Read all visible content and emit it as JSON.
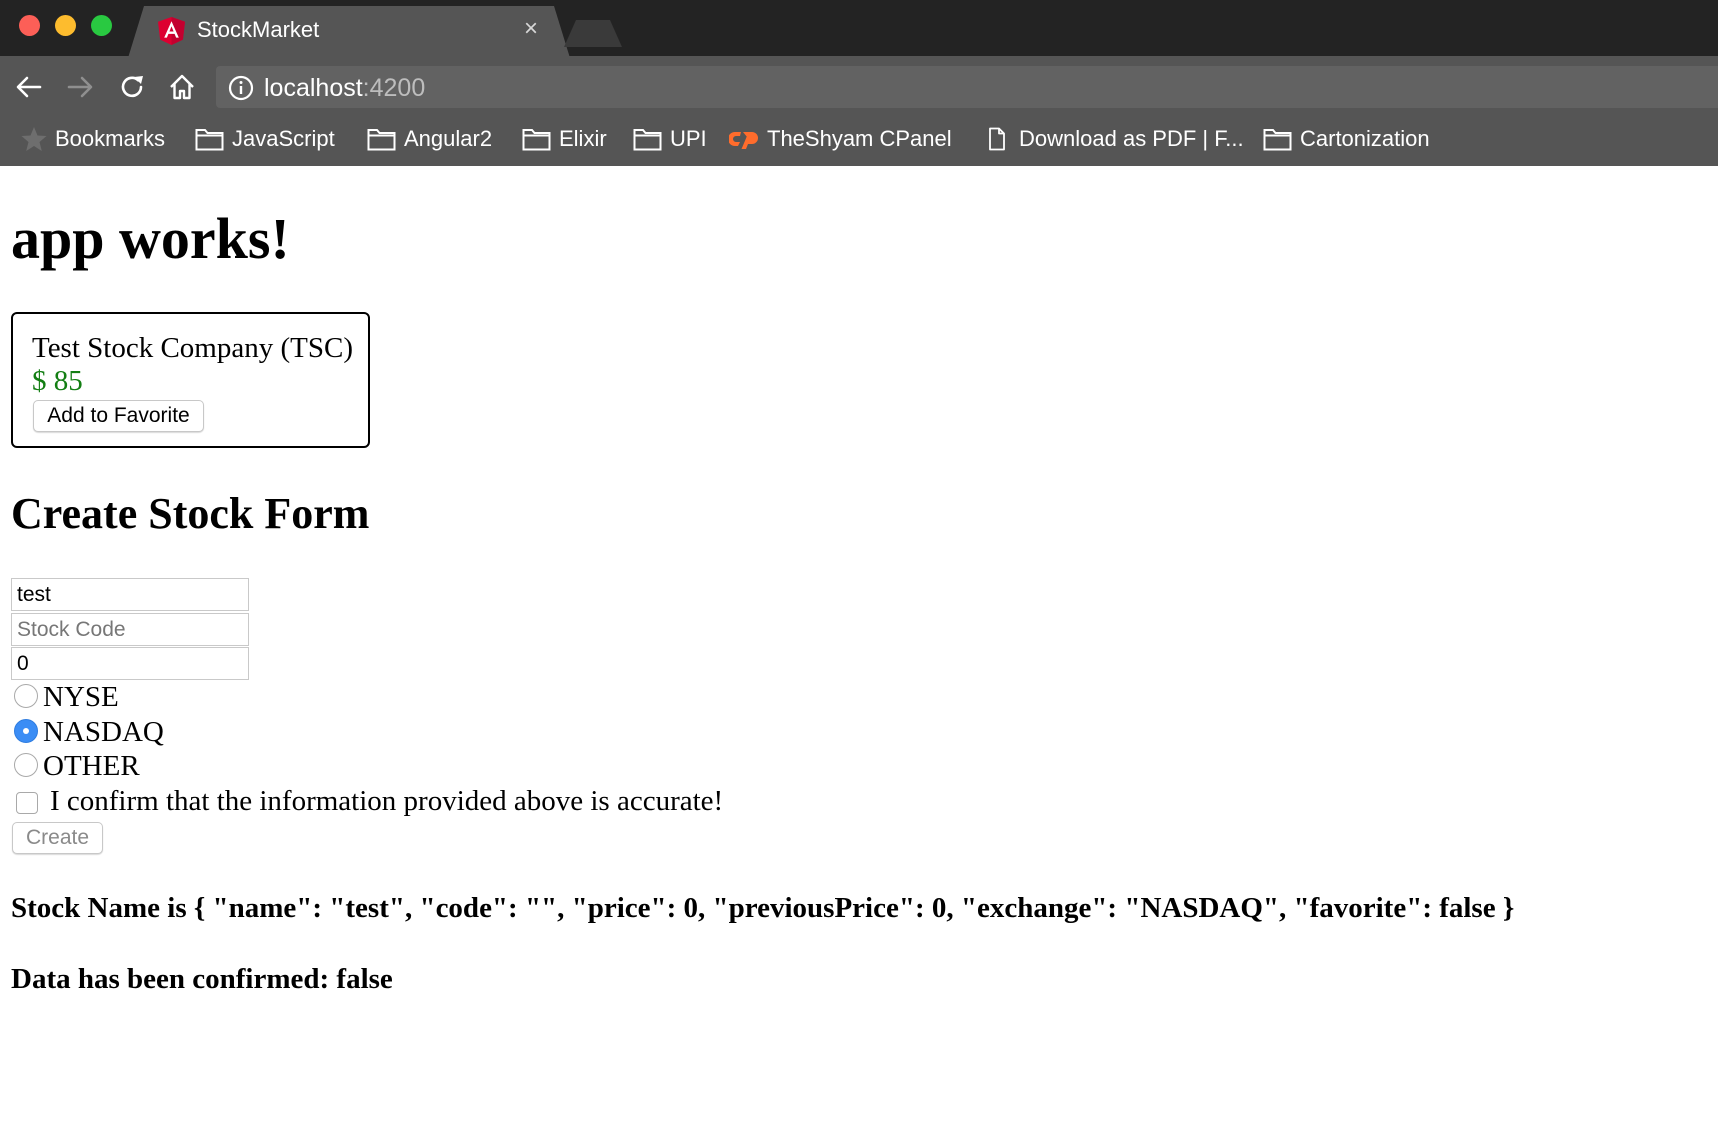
{
  "browser": {
    "tab_title": "StockMarket",
    "tab_close": "×",
    "url_host": "localhost",
    "url_port": ":4200",
    "bookmarks": [
      {
        "label": "Bookmarks"
      },
      {
        "label": "JavaScript"
      },
      {
        "label": "Angular2"
      },
      {
        "label": "Elixir"
      },
      {
        "label": "UPI"
      },
      {
        "label": "TheShyam CPanel"
      },
      {
        "label": "Download as PDF | F..."
      },
      {
        "label": "Cartonization"
      }
    ]
  },
  "app": {
    "heading": "app works!",
    "stock_card": {
      "name": "Test Stock Company (TSC)",
      "price": "$ 85",
      "favorite_button": "Add to Favorite"
    },
    "form": {
      "heading": "Create Stock Form",
      "name_value": "test",
      "code_placeholder": "Stock Code",
      "price_value": "0",
      "exchanges": [
        {
          "label": "NYSE",
          "selected": false
        },
        {
          "label": "NASDAQ",
          "selected": true
        },
        {
          "label": "OTHER",
          "selected": false
        }
      ],
      "confirm_label": "I confirm that the information provided above is accurate!",
      "confirm_checked": false,
      "create_button": "Create"
    },
    "output": {
      "stock_line": "Stock Name is { \"name\": \"test\", \"code\": \"\", \"price\": 0, \"previousPrice\": 0, \"exchange\": \"NASDAQ\", \"favorite\": false }",
      "confirmed_line": "Data has been confirmed: false"
    }
  },
  "colors": {
    "price_green": "#137e13",
    "radio_selected": "#3b8df5",
    "angular_red": "#dd0031",
    "cpanel_orange": "#ff6c2c"
  }
}
